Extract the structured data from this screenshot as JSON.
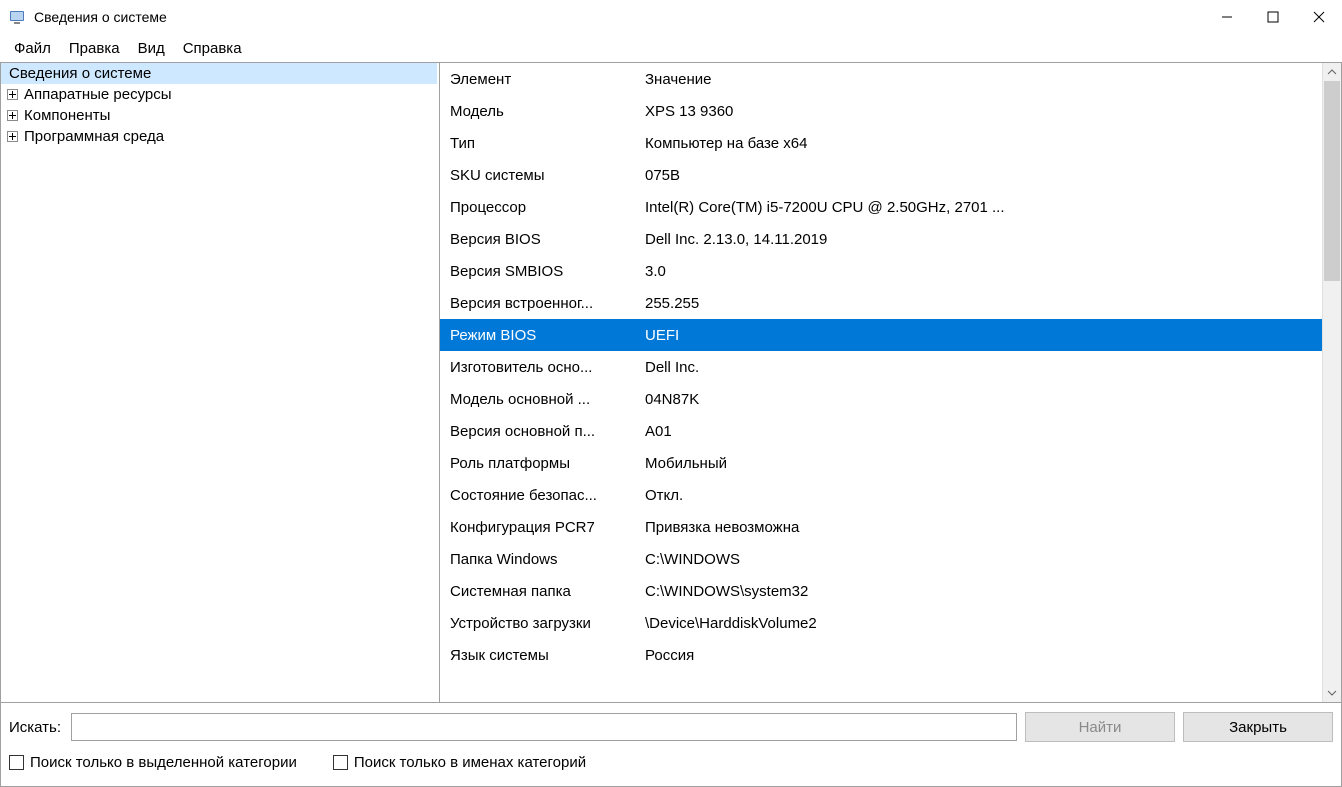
{
  "window": {
    "title": "Сведения о системе"
  },
  "menu": {
    "file": "Файл",
    "edit": "Правка",
    "view": "Вид",
    "help": "Справка"
  },
  "tree": {
    "root": "Сведения о системе",
    "items": [
      "Аппаратные ресурсы",
      "Компоненты",
      "Программная среда"
    ]
  },
  "columns": {
    "element": "Элемент",
    "value": "Значение"
  },
  "rows": [
    {
      "element": "Модель",
      "value": "XPS 13 9360"
    },
    {
      "element": "Тип",
      "value": "Компьютер на базе x64"
    },
    {
      "element": "SKU системы",
      "value": "075B"
    },
    {
      "element": "Процессор",
      "value": "Intel(R) Core(TM) i5-7200U CPU @ 2.50GHz, 2701 ..."
    },
    {
      "element": "Версия BIOS",
      "value": "Dell Inc. 2.13.0, 14.11.2019"
    },
    {
      "element": "Версия SMBIOS",
      "value": "3.0"
    },
    {
      "element": "Версия встроенног...",
      "value": "255.255"
    },
    {
      "element": "Режим BIOS",
      "value": "UEFI",
      "selected": true
    },
    {
      "element": "Изготовитель осно...",
      "value": "Dell Inc."
    },
    {
      "element": "Модель основной ...",
      "value": "04N87K"
    },
    {
      "element": "Версия основной п...",
      "value": "A01"
    },
    {
      "element": "Роль платформы",
      "value": "Мобильный"
    },
    {
      "element": "Состояние безопас...",
      "value": "Откл."
    },
    {
      "element": "Конфигурация PCR7",
      "value": "Привязка невозможна"
    },
    {
      "element": "Папка Windows",
      "value": "C:\\WINDOWS"
    },
    {
      "element": "Системная папка",
      "value": "C:\\WINDOWS\\system32"
    },
    {
      "element": "Устройство загрузки",
      "value": "\\Device\\HarddiskVolume2"
    },
    {
      "element": "Язык системы",
      "value": "Россия"
    }
  ],
  "search": {
    "label": "Искать:",
    "value": "",
    "find": "Найти",
    "close": "Закрыть",
    "cb_selected": "Поиск только в выделенной категории",
    "cb_names": "Поиск только в именах категорий"
  }
}
